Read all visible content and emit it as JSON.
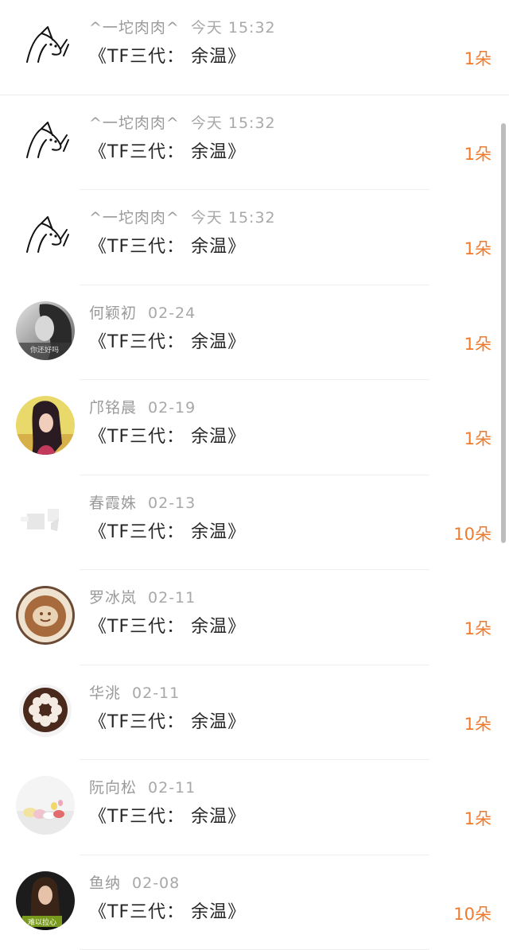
{
  "messages": [
    {
      "sender": "^一坨肉肉^",
      "time": "今天 15:32",
      "title": "《TF三代： 余温》",
      "count": "1朵",
      "avatar": "sketch-avatar"
    },
    {
      "sender": "^一坨肉肉^",
      "time": "今天 15:32",
      "title": "《TF三代： 余温》",
      "count": "1朵",
      "avatar": "sketch-avatar"
    },
    {
      "sender": "^一坨肉肉^",
      "time": "今天 15:32",
      "title": "《TF三代： 余温》",
      "count": "1朵",
      "avatar": "sketch-avatar"
    },
    {
      "sender": "何颖初",
      "time": "02-24",
      "title": "《TF三代： 余温》",
      "count": "1朵",
      "avatar": "bw-portrait-avatar",
      "avatar_caption": "你还好吗"
    },
    {
      "sender": "邝铭晨",
      "time": "02-19",
      "title": "《TF三代： 余温》",
      "count": "1朵",
      "avatar": "girl-yellow-avatar"
    },
    {
      "sender": "春霞姝",
      "time": "02-13",
      "title": "《TF三代： 余温》",
      "count": "10朵",
      "avatar": "faded-avatar"
    },
    {
      "sender": "罗冰岚",
      "time": "02-11",
      "title": "《TF三代： 余温》",
      "count": "1朵",
      "avatar": "latte-art-avatar"
    },
    {
      "sender": "华洮",
      "time": "02-11",
      "title": "《TF三代： 余温》",
      "count": "1朵",
      "avatar": "flower-cup-avatar"
    },
    {
      "sender": "阮向松",
      "time": "02-11",
      "title": "《TF三代： 余温》",
      "count": "1朵",
      "avatar": "macaron-avatar"
    },
    {
      "sender": "鱼纳",
      "time": "02-08",
      "title": "《TF三代： 余温》",
      "count": "10朵",
      "avatar": "dark-portrait-avatar",
      "avatar_caption": "难以拉心"
    }
  ],
  "colors": {
    "count_accent": "#f07a2d",
    "meta_gray": "#9a9a9a",
    "title_text": "#262626",
    "divider": "#efefef",
    "scrollbar": "#bdbdbd"
  }
}
